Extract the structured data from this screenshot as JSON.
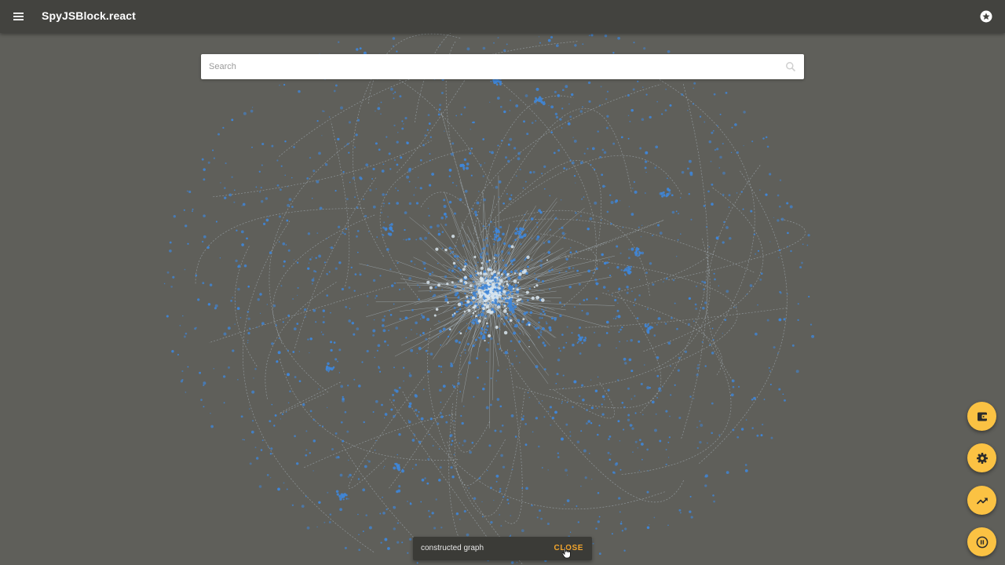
{
  "header": {
    "title": "SpyJSBlock.react",
    "menu_icon": "menu-icon",
    "star_icon": "star-circle-icon"
  },
  "search": {
    "placeholder": "Search",
    "value": "",
    "icon": "search-icon"
  },
  "fabs": [
    {
      "name": "wallet-icon"
    },
    {
      "name": "settings-icon"
    },
    {
      "name": "trending-up-icon"
    },
    {
      "name": "pause-circle-icon"
    }
  ],
  "snackbar": {
    "message": "constructed graph",
    "action_label": "CLOSE"
  },
  "colors": {
    "background": "#5f5f5a",
    "appbar": "#43433f",
    "fab": "#fbc243",
    "snackbar_action": "#f2a52d",
    "node": "#3f86d8",
    "edge": "#c9d9e6"
  }
}
